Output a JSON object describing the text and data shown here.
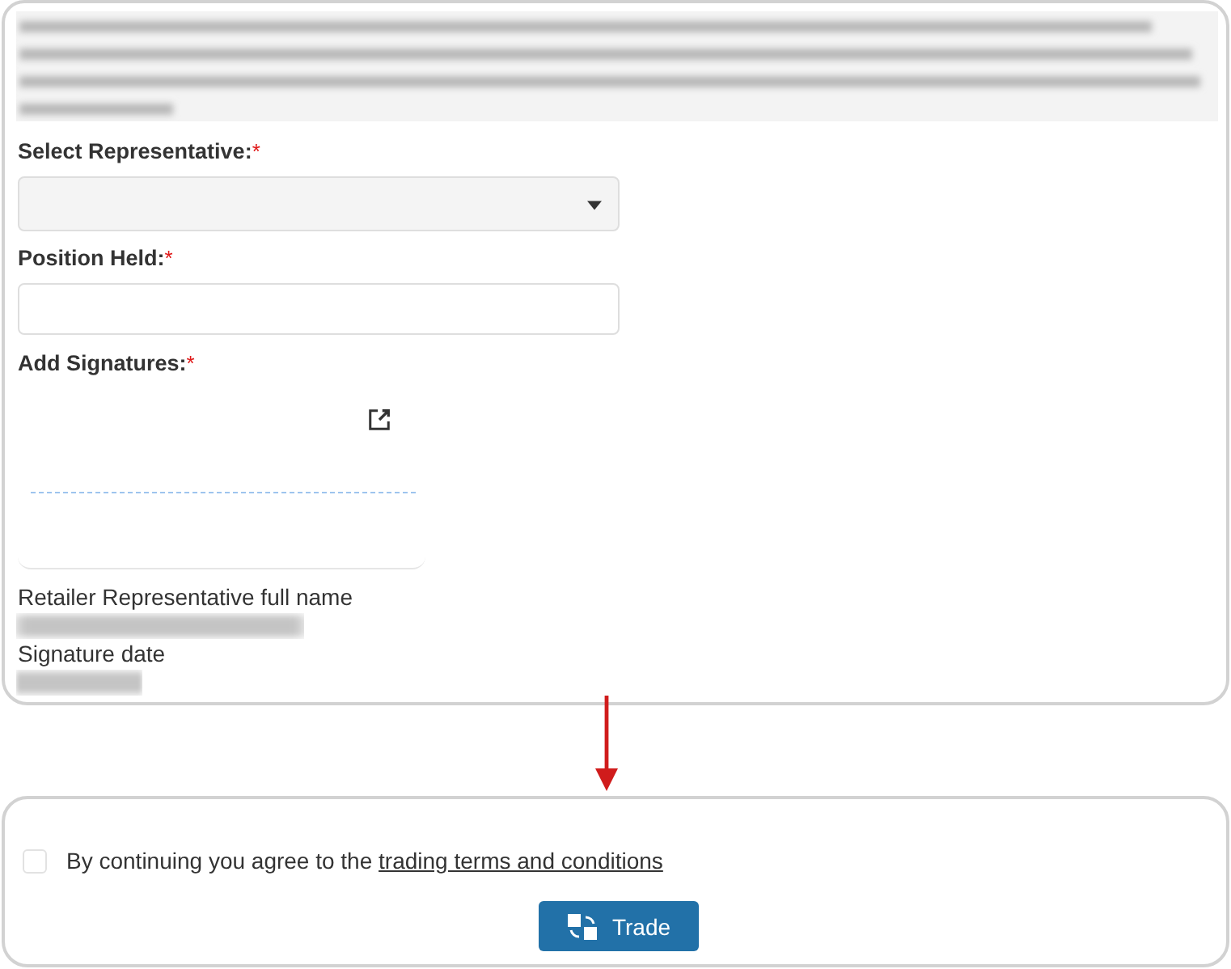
{
  "declaration": {
    "fields": [
      {
        "kind": "select",
        "label": "Select Representative:",
        "required_mark": "*"
      },
      {
        "kind": "text",
        "label": "Position Held:",
        "required_mark": "*"
      },
      {
        "kind": "signature",
        "label": "Add Signatures:",
        "required_mark": "*"
      }
    ],
    "signature_details": [
      {
        "label": "Retailer Representative full name"
      },
      {
        "label": "Signature date"
      }
    ]
  },
  "agreement": {
    "checked": false,
    "text": "By continuing you agree to the ",
    "link": "trading terms and conditions",
    "button": "Trade"
  }
}
